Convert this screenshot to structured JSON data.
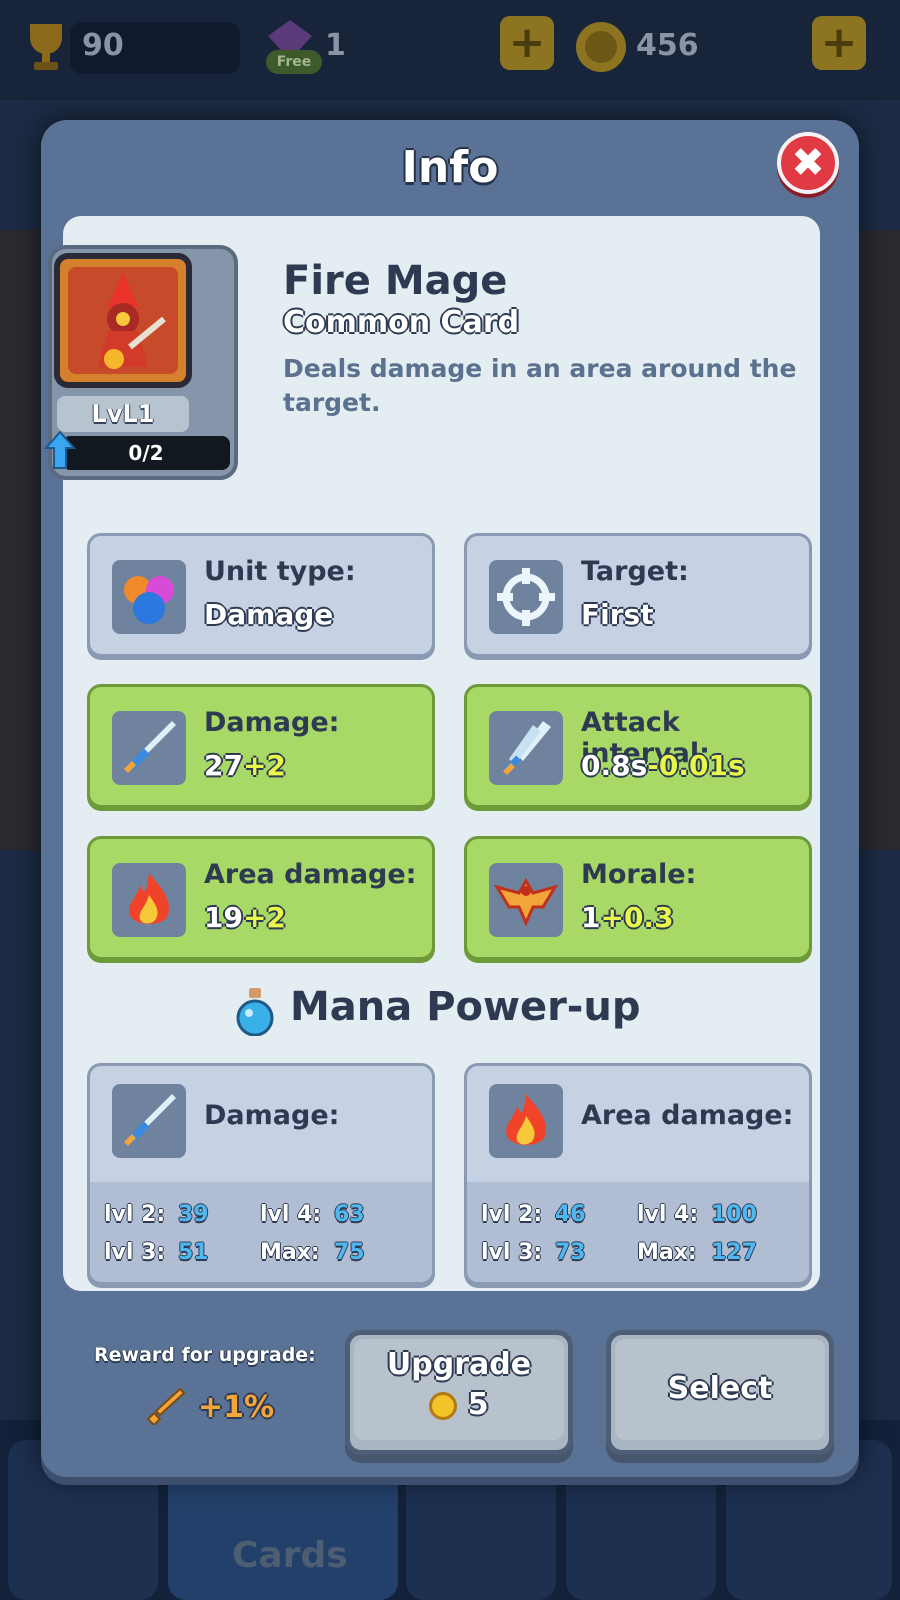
{
  "background": {
    "trophies": "90",
    "gems": "1",
    "gems_badge": "Free",
    "coins": "456",
    "plus": "+",
    "nav_tab_label": "Cards"
  },
  "modal": {
    "title": "Info",
    "close_symbol": "✖"
  },
  "card": {
    "name": "Fire Mage",
    "rarity": "Common Card",
    "description": "Deals damage in an area around the target.",
    "level": "LvL1",
    "progress": "0/2"
  },
  "stats": [
    {
      "label": "Unit type:",
      "value": "Damage",
      "bonus": "",
      "icon": "unit-type-icon",
      "style": "blue"
    },
    {
      "label": "Target:",
      "value": "First",
      "bonus": "",
      "icon": "target-icon",
      "style": "blue"
    },
    {
      "label": "Damage:",
      "value": "27",
      "bonus": "+2",
      "icon": "sword-icon",
      "style": "green"
    },
    {
      "label": "Attack interval:",
      "value": "0.8s",
      "bonus": "-0.01s",
      "icon": "attack-interval-icon",
      "style": "green"
    },
    {
      "label": "Area damage:",
      "value": "19",
      "bonus": "+2",
      "icon": "fire-icon",
      "style": "green"
    },
    {
      "label": "Morale:",
      "value": "1",
      "bonus": "+0.3",
      "icon": "eagle-icon",
      "style": "green"
    }
  ],
  "mana": {
    "title": "Mana Power-up",
    "cards": [
      {
        "label": "Damage:",
        "icon": "sword-icon",
        "levels": [
          {
            "name": "lvl 2:",
            "value": "39"
          },
          {
            "name": "lvl 3:",
            "value": "51"
          },
          {
            "name": "lvl 4:",
            "value": "63"
          },
          {
            "name": "Max:",
            "value": "75"
          }
        ]
      },
      {
        "label": "Area damage:",
        "icon": "fire-icon",
        "levels": [
          {
            "name": "lvl 2:",
            "value": "46"
          },
          {
            "name": "lvl 3:",
            "value": "73"
          },
          {
            "name": "lvl 4:",
            "value": "100"
          },
          {
            "name": "Max:",
            "value": "127"
          }
        ]
      }
    ]
  },
  "footer": {
    "reward_label": "Reward for upgrade:",
    "reward_value": "+1%",
    "upgrade_label": "Upgrade",
    "upgrade_cost": "5",
    "select_label": "Select"
  },
  "colors": {
    "modal_bg": "#5a7295",
    "panel_bg": "#e4edf2",
    "tile_blue": "#c7d1e4",
    "tile_green": "#a8d866",
    "bonus_yellow": "#e8f84a",
    "mana_value_blue": "#4fb8f0",
    "close_red": "#e23a44"
  }
}
